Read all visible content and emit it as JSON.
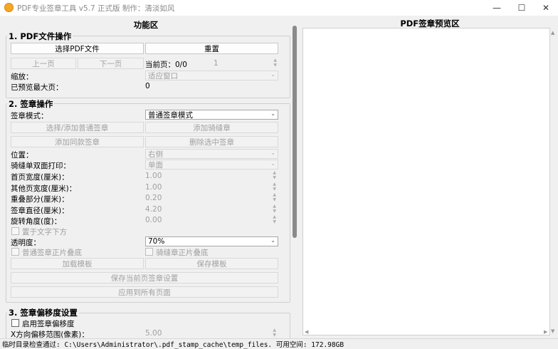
{
  "window": {
    "title": "PDF专业签章工具 v5.7 正式版    制作：清淡如风",
    "min": "—",
    "max": "☐",
    "close": "✕"
  },
  "left": {
    "header": "功能区",
    "pdf_ops": {
      "title": "1. PDF文件操作",
      "select_pdf": "选择PDF文件",
      "reset": "重置",
      "prev_page": "上一页",
      "next_page": "下一页",
      "current_page_label": "当前页：0/0",
      "page_input": "1",
      "zoom_label": "缩放：",
      "zoom_value": "适应窗口",
      "max_page_label": "已预览最大页：",
      "max_page_value": "0"
    },
    "stamp_ops": {
      "title": "2. 签章操作",
      "mode_label": "签章模式：",
      "mode_value": "普通签章模式",
      "select_normal": "选择/添加普通签章",
      "add_seam": "添加骑缝章",
      "add_same": "添加同款签章",
      "delete_selected": "删除选中签章",
      "position_label": "位置：",
      "position_value": "右侧",
      "seam_duplex_label": "骑缝单双面打印：",
      "seam_duplex_value": "单面",
      "first_width_label": "首页宽度(厘米)：",
      "first_width_value": "1.00",
      "other_width_label": "其他页宽度(厘米)：",
      "other_width_value": "1.00",
      "overlap_label": "重叠部分(厘米)：",
      "overlap_value": "0.20",
      "diameter_label": "签章直径(厘米)：",
      "diameter_value": "4.20",
      "rotation_label": "旋转角度(度)：",
      "rotation_value": "0.00",
      "below_text": "置于文字下方",
      "opacity_label": "透明度：",
      "opacity_value": "70%",
      "normal_multiply": "普通签章正片叠底",
      "seam_multiply": "骑缝章正片叠底",
      "load_template": "加载模板",
      "save_template": "保存模板",
      "save_page_settings": "保存当前页签章设置",
      "apply_all": "应用到所有页面"
    },
    "offset": {
      "title": "3. 签章偏移度设置",
      "enable": "启用签章偏移度",
      "x_range_label": "X方向偏移范围(像素)：",
      "x_range_value": "5.00"
    }
  },
  "right": {
    "title": "PDF签章预览区"
  },
  "status": {
    "text": "临时目录检查通过: C:\\Users\\Administrator\\.pdf_stamp_cache\\temp_files. 可用空间: 172.98GB"
  },
  "icons": {
    "dropdown": "⌄",
    "spin": "▲▼",
    "left": "◀",
    "right": "▶",
    "up": "▲",
    "down": "▼"
  }
}
